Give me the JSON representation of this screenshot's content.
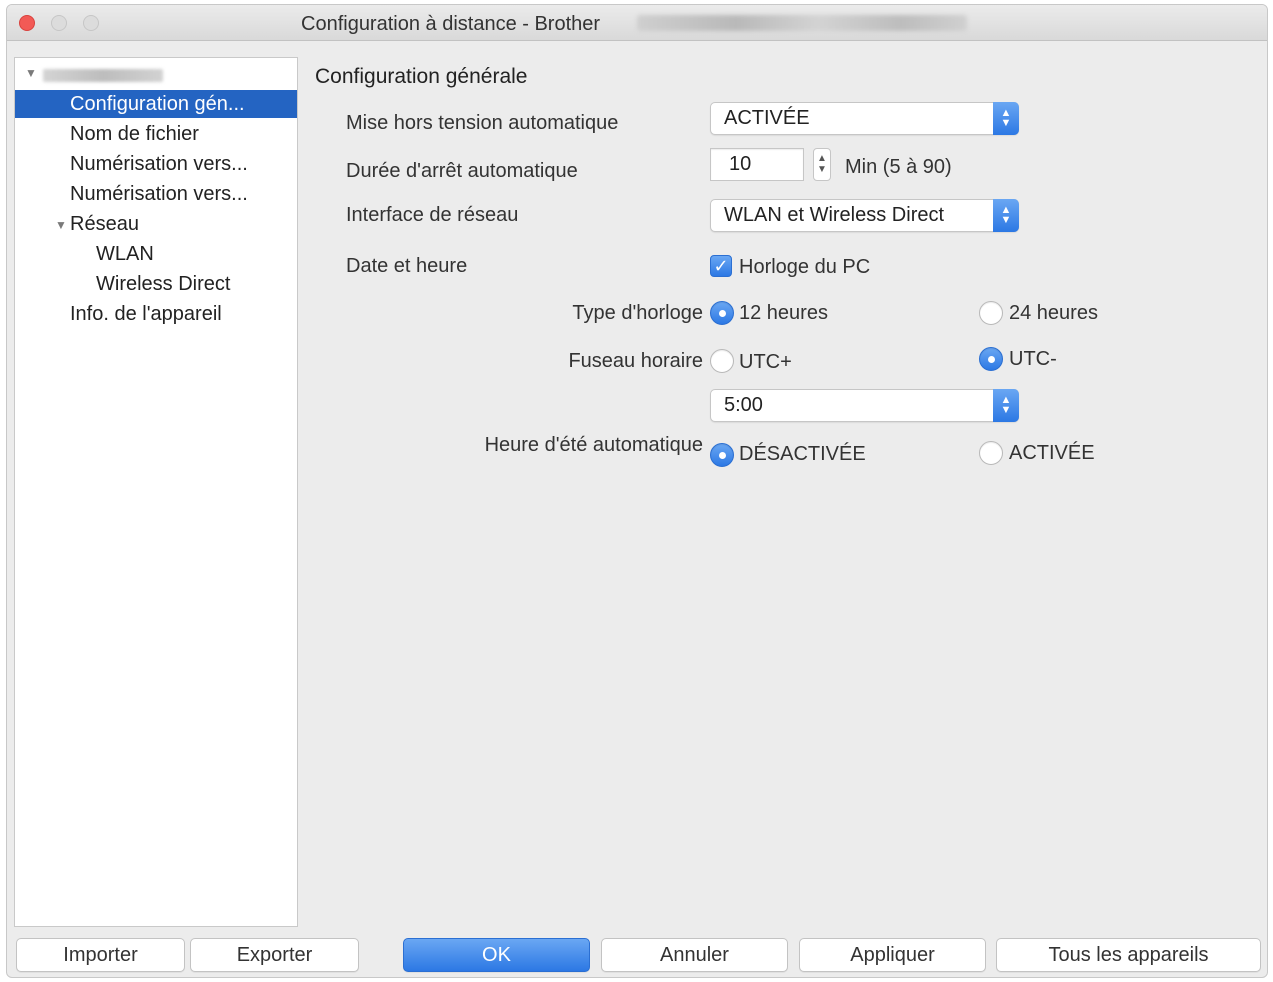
{
  "window": {
    "title": "Configuration à distance - Brother"
  },
  "sidebar": {
    "items": [
      {
        "label": "Configuration gén..."
      },
      {
        "label": "Nom de fichier"
      },
      {
        "label": "Numérisation vers..."
      },
      {
        "label": "Numérisation vers..."
      },
      {
        "label": "Réseau"
      },
      {
        "label": "WLAN"
      },
      {
        "label": "Wireless Direct"
      },
      {
        "label": "Info. de l'appareil"
      }
    ],
    "selected_index": 0
  },
  "panel": {
    "title": "Configuration générale",
    "auto_power_off": {
      "label": "Mise hors tension automatique",
      "value": "ACTIVÉE"
    },
    "auto_off_duration": {
      "label": "Durée d'arrêt automatique",
      "value": "10",
      "hint": "Min (5 à 90)"
    },
    "network_interface": {
      "label": "Interface de réseau",
      "value": "WLAN et Wireless Direct"
    },
    "date_time": {
      "label": "Date et heure",
      "checkbox_label": "Horloge du PC",
      "checked": true
    },
    "clock_type": {
      "label": "Type d'horloge",
      "option_a": "12 heures",
      "option_b": "24 heures",
      "selected": "12 heures"
    },
    "time_zone": {
      "label": "Fuseau horaire",
      "option_a": "UTC+",
      "option_b": "UTC-",
      "selected": "UTC-",
      "offset": "5:00"
    },
    "daylight_saving": {
      "label": "Heure d'été automatique",
      "option_a": "DÉSACTIVÉE",
      "option_b": "ACTIVÉE",
      "selected": "DÉSACTIVÉE"
    }
  },
  "buttons": {
    "import": "Importer",
    "export": "Exporter",
    "ok": "OK",
    "cancel": "Annuler",
    "apply": "Appliquer",
    "all_devices": "Tous les appareils"
  },
  "colors": {
    "accent": "#2c78e4",
    "selection": "#2464c2",
    "close_button": "#f25a56"
  }
}
